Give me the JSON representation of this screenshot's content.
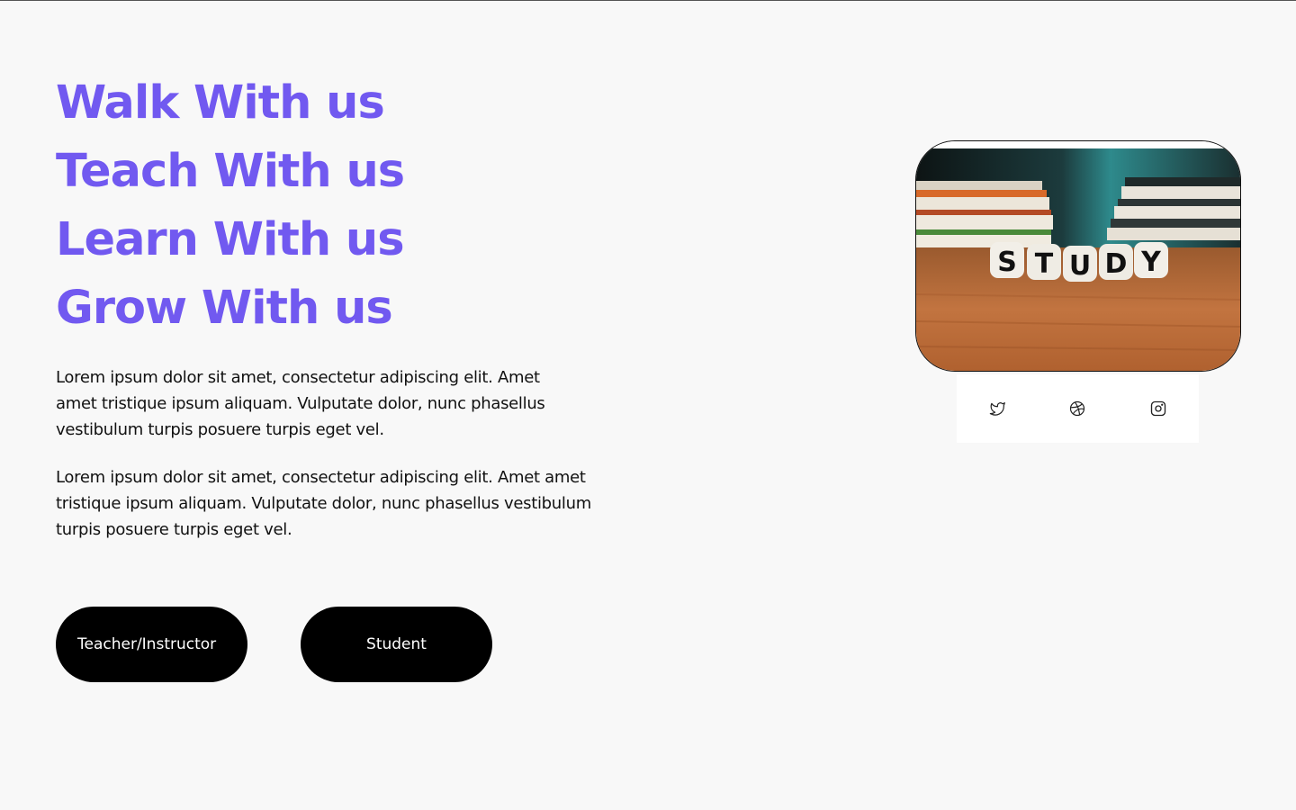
{
  "hero": {
    "headings": [
      "Walk With us",
      "Teach With us",
      "Learn With us",
      "Grow With us"
    ],
    "paragraph1": "Lorem ipsum dolor sit amet, consectetur adipiscing elit. Amet amet tristique ipsum aliquam. Vulputate dolor, nunc phasellus vestibulum turpis posuere turpis eget vel.",
    "paragraph2": "Lorem ipsum dolor sit amet, consectetur adipiscing elit. Amet amet tristique ipsum aliquam. Vulputate dolor, nunc phasellus vestibulum turpis posuere turpis eget vel.",
    "buttons": {
      "teacher_label": "Teacher/Instructor",
      "student_label": "Student"
    }
  },
  "image_card": {
    "dice_letters": "STUDY"
  },
  "social": {
    "icons": [
      "twitter-icon",
      "dribbble-icon",
      "instagram-icon"
    ]
  },
  "colors": {
    "accent": "#7159f0",
    "button_bg": "#000000",
    "page_bg": "#f8f8f8"
  }
}
